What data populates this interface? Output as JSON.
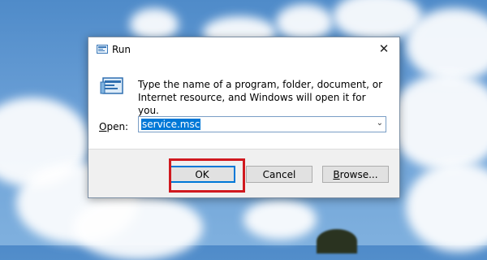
{
  "window": {
    "title": "Run",
    "title_icon": "run-icon",
    "close_icon": "close-icon",
    "close_glyph": "✕"
  },
  "content": {
    "icon": "run-icon",
    "description": "Type the name of a program, folder, document, or Internet resource, and Windows will open it for you."
  },
  "open_field": {
    "label": "Open:",
    "value": "service.msc",
    "dropdown_icon": "chevron-down-icon"
  },
  "buttons": {
    "ok": "OK",
    "cancel": "Cancel",
    "browse": "Browse..."
  },
  "colors": {
    "highlight": "#d0191f",
    "selection": "#0078d7"
  }
}
